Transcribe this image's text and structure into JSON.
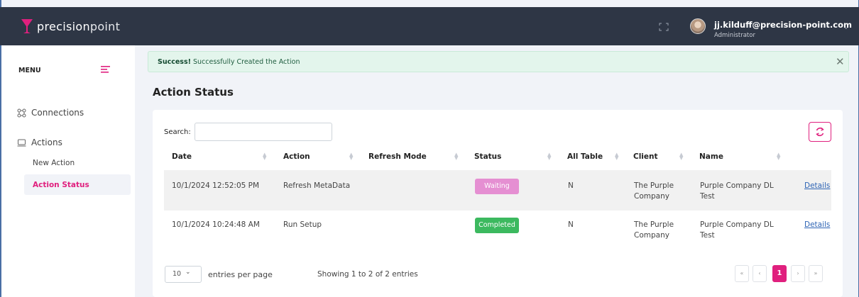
{
  "app": {
    "logo_text_prefix": "precision",
    "logo_text_suffix": "point"
  },
  "user": {
    "email": "jj.kilduff@precision-point.com",
    "role": "Administrator"
  },
  "sidebar": {
    "menu_label": "MENU",
    "connections": "Connections",
    "actions": "Actions",
    "new_action": "New Action",
    "action_status": "Action Status"
  },
  "alert": {
    "strong": "Success!",
    "message": " Successfully Created the Action"
  },
  "page": {
    "title": "Action Status"
  },
  "search": {
    "label": "Search:",
    "value": ""
  },
  "table": {
    "headers": [
      "Date",
      "Action",
      "Refresh Mode",
      "Status",
      "All Table",
      "Client",
      "Name"
    ],
    "rows": [
      {
        "date": "10/1/2024 12:52:05 PM",
        "action": "Refresh MetaData",
        "refresh_mode": "",
        "status": "Waiting",
        "all_table": "N",
        "client_line1": "The Purple",
        "client_line2": "Company",
        "name_line1": "Purple Company DL",
        "name_line2": "Test",
        "details": "Details"
      },
      {
        "date": "10/1/2024 10:24:48 AM",
        "action": "Run Setup",
        "refresh_mode": "",
        "status": "Completed",
        "all_table": "N",
        "client_line1": "The Purple",
        "client_line2": "Company",
        "name_line1": "Purple Company DL",
        "name_line2": "Test",
        "details": "Details"
      }
    ]
  },
  "footer": {
    "per_page_value": "10",
    "per_page_label": "entries per page",
    "showing": "Showing 1 to 2 of 2 entries",
    "pages": [
      "«",
      "‹",
      "1",
      "›",
      "»"
    ]
  },
  "colors": {
    "accent": "#e0207e",
    "topbar": "#2e3645",
    "waiting": "#e58fd2",
    "completed": "#3cb95f",
    "link": "#2f65b5"
  },
  "icons": [
    "fullscreen-icon",
    "hamburger-icon",
    "connections-icon",
    "actions-icon",
    "refresh-icon"
  ]
}
